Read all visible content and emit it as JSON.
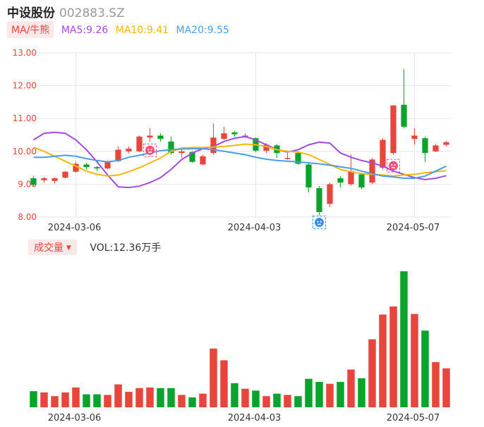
{
  "header": {
    "name": "中设股份",
    "code": "002883.SZ"
  },
  "ma": {
    "mode_label": "MA/牛熊",
    "items": [
      {
        "label": "MA5:9.26",
        "color": "#a349e8"
      },
      {
        "label": "MA10:9.41",
        "color": "#f5b800"
      },
      {
        "label": "MA20:9.55",
        "color": "#4a9ee8"
      }
    ]
  },
  "volume": {
    "mode_label": "成交量",
    "caret": "▼",
    "label": "VOL:12.36万手"
  },
  "colors": {
    "up": "#e8453c",
    "down": "#0aa32c",
    "grid": "#e6e6e6",
    "marker": "#ff4d7a",
    "marker_blue": "#3b8be8"
  },
  "icons": {
    "bull_marker": "bull-face-icon",
    "bear_marker": "bear-face-icon"
  },
  "chart_data": {
    "type": "candlestick",
    "price_axis": {
      "ticks": [
        "13.00",
        "12.00",
        "11.00",
        "10.00",
        "9.00",
        "8.00"
      ],
      "ylim": [
        8.0,
        13.0
      ]
    },
    "x_tick_labels": [
      "2024-03-06",
      "2024-04-03",
      "2024-05-07"
    ],
    "x_tick_indices": [
      4,
      21,
      36
    ],
    "candles": [
      [
        9.18,
        8.98,
        9.25,
        8.95
      ],
      [
        9.12,
        9.18,
        9.22,
        9.05
      ],
      [
        9.1,
        9.18,
        9.2,
        9.02
      ],
      [
        9.2,
        9.38,
        9.4,
        9.18
      ],
      [
        9.38,
        9.62,
        9.68,
        9.35
      ],
      [
        9.6,
        9.52,
        9.65,
        9.45
      ],
      [
        9.52,
        9.48,
        9.55,
        9.4
      ],
      [
        9.48,
        9.7,
        9.72,
        9.45
      ],
      [
        9.7,
        10.05,
        10.15,
        9.68
      ],
      [
        10.0,
        10.08,
        10.15,
        9.95
      ],
      [
        10.0,
        10.45,
        10.48,
        9.98
      ],
      [
        10.42,
        10.48,
        10.7,
        10.3
      ],
      [
        10.48,
        10.38,
        10.55,
        10.3
      ],
      [
        10.3,
        9.95,
        10.45,
        9.9
      ],
      [
        9.95,
        10.0,
        10.1,
        9.8
      ],
      [
        9.98,
        9.68,
        10.0,
        9.65
      ],
      [
        9.6,
        9.85,
        9.9,
        9.58
      ],
      [
        9.95,
        10.42,
        10.85,
        9.9
      ],
      [
        10.38,
        10.55,
        10.75,
        10.35
      ],
      [
        10.58,
        10.52,
        10.62,
        10.45
      ],
      [
        10.48,
        10.48,
        10.55,
        10.4
      ],
      [
        10.4,
        10.02,
        10.42,
        9.98
      ],
      [
        10.02,
        10.2,
        10.25,
        9.95
      ],
      [
        10.18,
        9.95,
        10.22,
        9.8
      ],
      [
        9.78,
        9.8,
        9.95,
        9.75
      ],
      [
        9.95,
        9.62,
        10.0,
        9.6
      ],
      [
        9.6,
        8.9,
        9.65,
        8.75
      ],
      [
        8.88,
        8.15,
        8.95,
        8.05
      ],
      [
        8.4,
        9.0,
        9.05,
        8.3
      ],
      [
        9.18,
        9.05,
        9.25,
        8.9
      ],
      [
        9.0,
        9.4,
        9.9,
        8.95
      ],
      [
        9.3,
        8.9,
        9.35,
        8.85
      ],
      [
        9.05,
        9.75,
        9.8,
        9.0
      ],
      [
        9.5,
        10.35,
        10.4,
        9.45
      ],
      [
        9.95,
        11.4,
        11.4,
        9.9
      ],
      [
        11.42,
        10.75,
        12.5,
        10.7
      ],
      [
        10.38,
        10.48,
        10.7,
        10.2
      ],
      [
        10.4,
        9.95,
        10.45,
        9.68
      ],
      [
        10.0,
        10.18,
        10.22,
        9.98
      ],
      [
        10.2,
        10.28,
        10.32,
        10.15
      ]
    ],
    "series": [
      {
        "name": "MA5",
        "values": [
          10.35,
          10.55,
          10.58,
          10.55,
          10.35,
          10.05,
          9.68,
          9.28,
          8.92,
          8.9,
          8.94,
          9.05,
          9.2,
          9.45,
          9.75,
          9.95,
          10.08,
          10.15,
          10.3,
          10.4,
          10.45,
          10.35,
          10.2,
          10.05,
          9.98,
          10.05,
          10.2,
          10.28,
          10.25,
          9.95,
          9.82,
          9.72,
          9.65,
          9.55,
          9.4,
          9.3,
          9.2,
          9.14,
          9.18,
          9.26
        ]
      },
      {
        "name": "MA10",
        "values": [
          10.12,
          10.0,
          9.85,
          9.7,
          9.55,
          9.4,
          9.3,
          9.25,
          9.28,
          9.38,
          9.5,
          9.65,
          9.8,
          10.0,
          10.1,
          10.12,
          10.12,
          10.13,
          10.15,
          10.18,
          10.22,
          10.2,
          10.15,
          10.05,
          10.0,
          9.98,
          9.9,
          9.75,
          9.6,
          9.45,
          9.38,
          9.32,
          9.3,
          9.28,
          9.25,
          9.28,
          9.3,
          9.35,
          9.38,
          9.41
        ]
      },
      {
        "name": "MA20",
        "values": [
          9.82,
          9.82,
          9.85,
          9.88,
          9.85,
          9.78,
          9.72,
          9.68,
          9.72,
          9.82,
          9.88,
          9.95,
          10.02,
          10.05,
          10.07,
          10.08,
          10.08,
          10.05,
          10.0,
          9.95,
          9.9,
          9.82,
          9.76,
          9.72,
          9.7,
          9.68,
          9.65,
          9.62,
          9.58,
          9.53,
          9.48,
          9.4,
          9.32,
          9.25,
          9.22,
          9.18,
          9.18,
          9.25,
          9.4,
          9.55
        ]
      }
    ],
    "volume_bars": [
      26,
      24,
      18,
      24,
      32,
      21,
      21,
      20,
      37,
      25,
      31,
      32,
      31,
      31,
      20,
      16,
      22,
      95,
      76,
      39,
      30,
      27,
      18,
      22,
      20,
      18,
      46,
      41,
      38,
      41,
      61,
      47,
      110,
      150,
      163,
      220,
      151,
      124,
      73,
      63
    ],
    "markers": [
      {
        "index": 11,
        "type": "bull"
      },
      {
        "index": 27,
        "type": "bear"
      },
      {
        "index": 34,
        "type": "bull"
      }
    ]
  }
}
